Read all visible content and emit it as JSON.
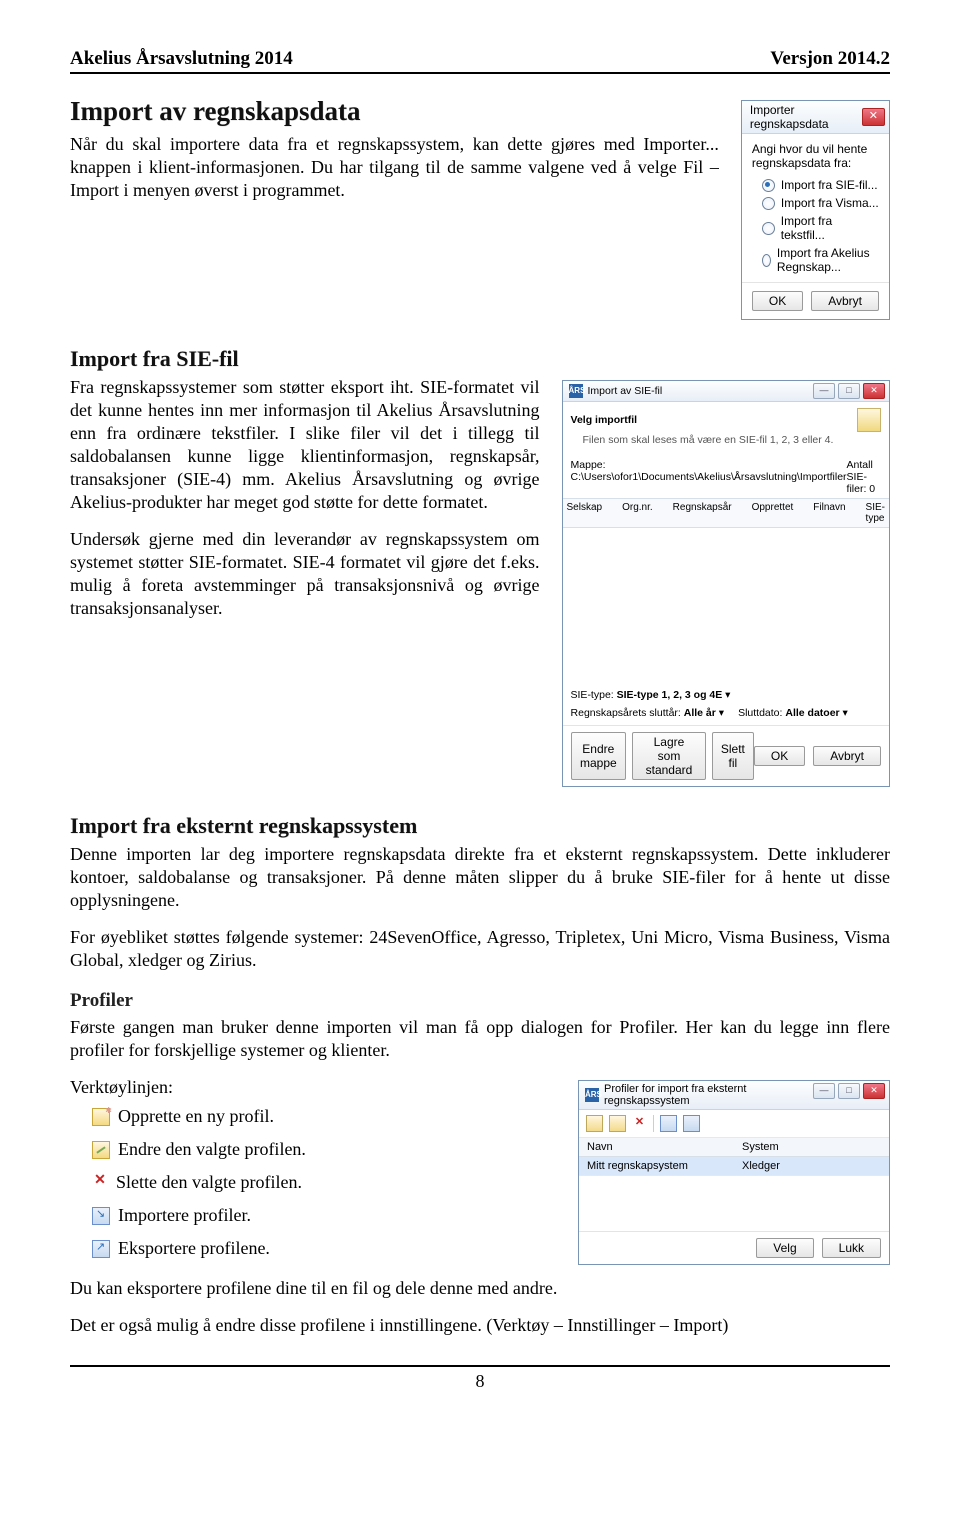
{
  "header": {
    "left": "Akelius Årsavslutning 2014",
    "right": "Versjon 2014.2"
  },
  "h1": "Import av regnskapsdata",
  "p1": "Når du skal importere data fra et regnskapssystem, kan dette gjøres med Importer... knappen i klient-informasjonen. Du har tilgang til de samme valgene ved å velge Fil – Import i menyen øverst i programmet.",
  "dialog1": {
    "title": "Importer regnskapsdata",
    "prompt": "Angi hvor du vil hente regnskapsdata fra:",
    "options": [
      "Import fra SIE-fil...",
      "Import fra Visma...",
      "Import fra tekstfil...",
      "Import fra Akelius Regnskap..."
    ],
    "ok": "OK",
    "cancel": "Avbryt"
  },
  "h2a": "Import fra SIE-fil",
  "p2": "Fra regnskapssystemer som støtter eksport iht. SIE-formatet vil det kunne hentes inn mer informasjon til Akelius Årsavslutning enn fra ordinære tekstfiler. I slike filer vil det i tillegg til saldobalansen kunne ligge klientinformasjon, regnskapsår, transaksjoner (SIE-4) mm. Akelius Årsavslutning og øvrige Akelius-produkter har meget god støtte for dette formatet.",
  "p3": "Undersøk gjerne med din leverandør av regnskapssystem om systemet støtter SIE-formatet. SIE-4 formatet vil gjøre det f.eks. mulig å foreta avstemminger på transaksjonsnivå og øvrige transaksjonsanalyser.",
  "dialog2": {
    "title": "Import av SIE-fil",
    "group": "Velg importfil",
    "hint": "Filen som skal leses må være en SIE-fil 1, 2, 3 eller 4.",
    "path_label": "Mappe:",
    "path": "C:\\Users\\ofor1\\Documents\\Akelius\\Årsavslutning\\Importfiler",
    "count_label": "Antall SIE-filer:",
    "count": "0",
    "cols": [
      "Selskap",
      "Org.nr.",
      "Regnskapsår",
      "Opprettet",
      "Filnavn",
      "SIE-type"
    ],
    "filters": {
      "sie_label": "SIE-type:",
      "sie_val": "SIE-type 1, 2, 3 og 4E",
      "end_label": "Regnskapsårets sluttår:",
      "end_val": "Alle år",
      "date_label": "Sluttdato:",
      "date_val": "Alle datoer"
    },
    "btns": {
      "folder": "Endre mappe",
      "std": "Lagre som standard",
      "del": "Slett fil",
      "ok": "OK",
      "cancel": "Avbryt"
    }
  },
  "h2b": "Import fra eksternt regnskapssystem",
  "p4": "Denne importen lar deg importere regnskapsdata direkte fra et eksternt regnskapssystem. Dette inkluderer kontoer, saldobalanse og transaksjoner. På denne måten slipper du å bruke SIE-filer for å hente ut disse opplysningene.",
  "p5": "For øyebliket støttes følgende systemer: 24SevenOffice, Agresso, Tripletex, Uni Micro, Visma Business, Visma Global, xledger og Zirius.",
  "h3a": "Profiler",
  "p6": "Første gangen man bruker denne importen vil man få opp dialogen for Profiler. Her kan du legge inn flere profiler for forskjellige systemer og klienter.",
  "p7": "Verktøylinjen:",
  "toolbar_items": [
    "Opprette en ny profil.",
    "Endre den valgte profilen.",
    "Slette den valgte profilen.",
    "Importere profiler.",
    "Eksportere profilene."
  ],
  "dialog3": {
    "title": "Profiler for import fra eksternt regnskapssystem",
    "cols": [
      "Navn",
      "System"
    ],
    "row": [
      "Mitt regnskapsystem",
      "Xledger"
    ],
    "ok": "Velg",
    "cancel": "Lukk"
  },
  "p8": "Du kan eksportere profilene dine til en fil og dele denne med andre.",
  "p9": "Det er også mulig å endre disse profilene i innstillingene. (Verktøy – Innstillinger – Import)",
  "page_num": "8"
}
